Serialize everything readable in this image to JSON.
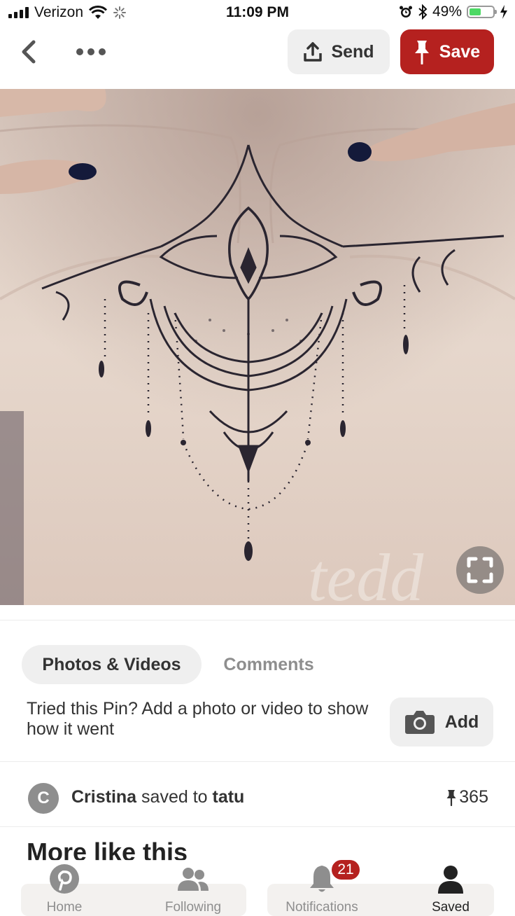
{
  "status_bar": {
    "carrier": "Verizon",
    "time": "11:09 PM",
    "battery": "49%",
    "battery_level": 0.49,
    "icons": [
      "signal-icon",
      "wifi-icon",
      "activity-spinner-icon",
      "alarm-icon",
      "bluetooth-icon",
      "battery-icon",
      "charging-icon"
    ]
  },
  "header": {
    "send_label": "Send",
    "save_label": "Save",
    "icons": [
      "back-chevron-icon",
      "more-dots-icon",
      "share-upload-icon",
      "pushpin-icon"
    ]
  },
  "pin": {
    "watermark": "tedd",
    "icons": [
      "expand-icon"
    ]
  },
  "tabs": [
    {
      "label": "Photos & Videos",
      "active": true
    },
    {
      "label": "Comments",
      "active": false
    }
  ],
  "tried": {
    "text": "Tried this Pin? Add a photo or video to show how it went",
    "add_label": "Add",
    "icons": [
      "camera-icon"
    ]
  },
  "saved_by": {
    "avatar_initial": "C",
    "user": "Cristina",
    "action": " saved to ",
    "board": "tatu",
    "count": "365",
    "icons": [
      "pushpin-icon"
    ]
  },
  "more_like_this": {
    "title": "More like this"
  },
  "bottom_nav": {
    "items": [
      {
        "label": "Home",
        "icon": "pinterest-logo-icon",
        "active": false
      },
      {
        "label": "Following",
        "icon": "people-icon",
        "active": false
      },
      {
        "label": "Notifications",
        "icon": "bell-icon",
        "active": false
      },
      {
        "label": "Saved",
        "icon": "person-icon",
        "active": true
      }
    ],
    "notifications_badge": "21"
  },
  "colors": {
    "accent": "#b5211f",
    "button_bg": "#efefef",
    "muted_text": "#8e8e8e",
    "text": "#333333"
  }
}
